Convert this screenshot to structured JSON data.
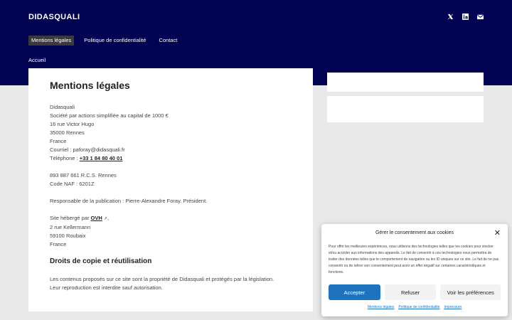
{
  "header": {
    "brand": "DIDASQUALI",
    "nav": [
      "Mentions légales",
      "Politique de confidentialité",
      "Contact"
    ],
    "social_icons": [
      "x-twitter-icon",
      "linkedin-icon",
      "envelope-icon"
    ],
    "background_color": "#010252"
  },
  "breadcrumb": "Accueil",
  "main": {
    "title": "Mentions légales",
    "company": "Didasquali",
    "company_desc": "Société par actions simplifiée au capital de 1000 €",
    "address1": "16 rue Victor Hugo",
    "address2": "35000 Rennes",
    "country": "France",
    "email_line": "Courriel : paforay@didasquali.fr",
    "phone_label": "Téléphone : ",
    "phone": "+33 1 84 80 40 01",
    "rcs": "893 887 661 R.C.S. Rennes",
    "naf": "Code NAF : 6201Z",
    "publication": "Responsable de la publication : Pierre-Alexandre Foray. Président.",
    "host_label": "Site hébergé par ",
    "host": "OVH",
    "host_suffix": ",",
    "host_addr1": "2 rue Kellermann",
    "host_addr2": "59100 Roubaix",
    "host_country": "France",
    "section2_title": "Droits de copie et réutilisation",
    "section2_line1": "Les contenus proposés sur ce site sont la propriété de Didasquali et protégés par la législation.",
    "section2_line2": "Leur reproduction est interdite sauf autorisation."
  },
  "cookie": {
    "title": "Gérer le consentement aux cookies",
    "text": "Pour offrir les meilleures expériences, nous utilisons des technologies telles que les cookies pour stocker et/ou accéder aux informations des appareils. Le fait de consentir à ces technologies nous permettra de traiter des données telles que le comportement de navigation ou les ID uniques sur ce site. Le fait de ne pas consentir ou de retirer son consentement peut avoir un effet négatif sur certaines caractéristiques et fonctions.",
    "accept": "Accepter",
    "refuse": "Refuser",
    "prefs": "Voir les préférences",
    "links": [
      "Mentions légales",
      "Politique de confidentialité",
      "Impressum"
    ],
    "accent_color": "#1e73be"
  }
}
